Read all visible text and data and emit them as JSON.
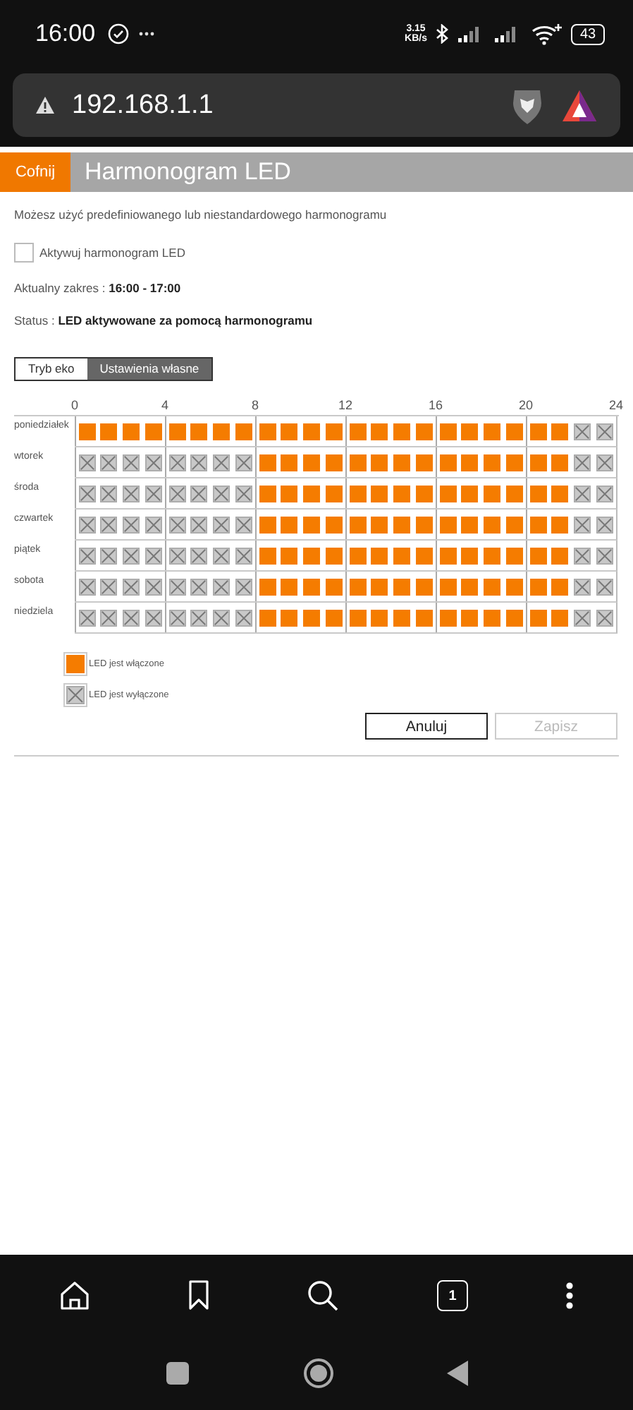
{
  "status_bar": {
    "time": "16:00",
    "speed": "3.15",
    "speed_unit": "KB/s",
    "battery": "43"
  },
  "browser": {
    "url": "192.168.1.1"
  },
  "header": {
    "back": "Cofnij",
    "title": "Harmonogram LED"
  },
  "intro": "Możesz użyć predefiniowanego lub niestandardowego harmonogramu",
  "activate": {
    "label": "Aktywuj harmonogram LED",
    "checked": false
  },
  "range": "Aktualny zakres : **16:00 - 17:00**",
  "status": "Status : **LED aktywowane za pomocą harmonogramu**",
  "modes": [
    {
      "label": "Tryb eko",
      "selected": false
    },
    {
      "label": "Ustawienia własne",
      "selected": true
    }
  ],
  "schedule": {
    "hour_ticks": [
      "0",
      "4",
      "8",
      "12",
      "16",
      "20",
      "24"
    ],
    "days": [
      {
        "name": "poniedziałek",
        "hours": [
          true,
          true,
          true,
          true,
          true,
          true,
          true,
          true,
          true,
          true,
          true,
          true,
          true,
          true,
          true,
          true,
          true,
          true,
          true,
          true,
          true,
          true,
          false,
          false
        ]
      },
      {
        "name": "wtorek",
        "hours": [
          false,
          false,
          false,
          false,
          false,
          false,
          false,
          false,
          true,
          true,
          true,
          true,
          true,
          true,
          true,
          true,
          true,
          true,
          true,
          true,
          true,
          true,
          false,
          false
        ]
      },
      {
        "name": "środa",
        "hours": [
          false,
          false,
          false,
          false,
          false,
          false,
          false,
          false,
          true,
          true,
          true,
          true,
          true,
          true,
          true,
          true,
          true,
          true,
          true,
          true,
          true,
          true,
          false,
          false
        ]
      },
      {
        "name": "czwartek",
        "hours": [
          false,
          false,
          false,
          false,
          false,
          false,
          false,
          false,
          true,
          true,
          true,
          true,
          true,
          true,
          true,
          true,
          true,
          true,
          true,
          true,
          true,
          true,
          false,
          false
        ]
      },
      {
        "name": "piątek",
        "hours": [
          false,
          false,
          false,
          false,
          false,
          false,
          false,
          false,
          true,
          true,
          true,
          true,
          true,
          true,
          true,
          true,
          true,
          true,
          true,
          true,
          true,
          true,
          false,
          false
        ]
      },
      {
        "name": "sobota",
        "hours": [
          false,
          false,
          false,
          false,
          false,
          false,
          false,
          false,
          true,
          true,
          true,
          true,
          true,
          true,
          true,
          true,
          true,
          true,
          true,
          true,
          true,
          true,
          false,
          false
        ]
      },
      {
        "name": "niedziela",
        "hours": [
          false,
          false,
          false,
          false,
          false,
          false,
          false,
          false,
          true,
          true,
          true,
          true,
          true,
          true,
          true,
          true,
          true,
          true,
          true,
          true,
          true,
          true,
          false,
          false
        ]
      }
    ]
  },
  "legend": [
    {
      "on": true,
      "label": "LED jest włączone"
    },
    {
      "on": false,
      "label": "LED jest wyłączone"
    }
  ],
  "buttons": [
    {
      "label": "Anuluj",
      "disabled": false
    },
    {
      "label": "Zapisz",
      "disabled": true
    }
  ],
  "tab_count": "1"
}
